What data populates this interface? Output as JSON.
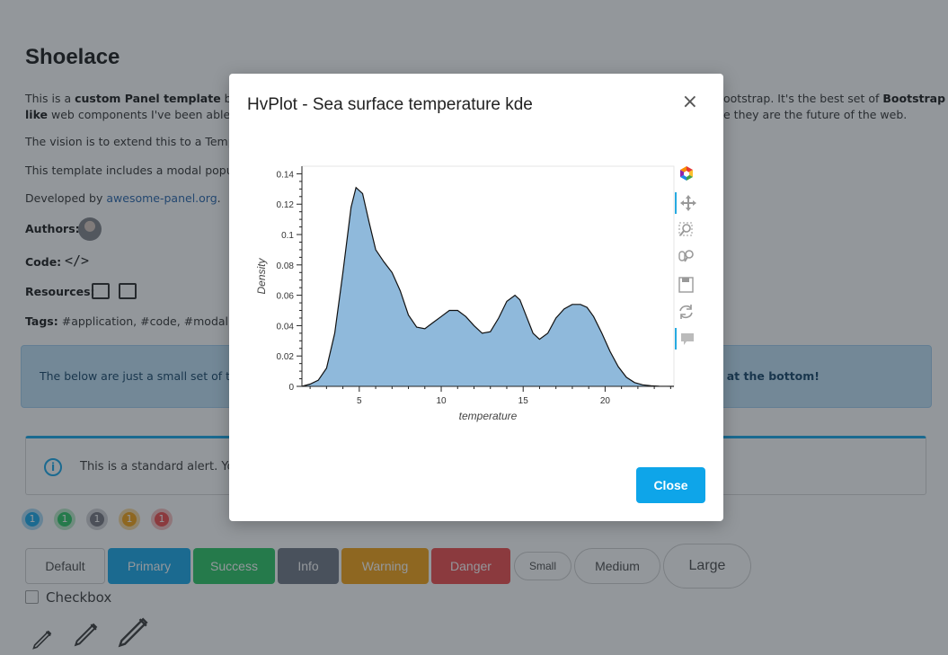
{
  "page": {
    "title": "Shoelace",
    "intro": {
      "text_1": "This is a ",
      "bold_1": "custom Panel template",
      "text_2": " based",
      "text_3": "ootstrap. It's the best set of ",
      "bold_2": "Bootstrap",
      "line2_bold": "like",
      "line2_text": " web components I've been able to",
      "line2_right": "e they are the future of the web."
    },
    "vision": "The vision is to extend this to a Templat",
    "includes": "This template includes a modal popup v",
    "developed_prefix": "Developed by ",
    "developed_link": "awesome-panel.org",
    "developed_suffix": ".",
    "authors_label": "Authors:",
    "code_label": "Code:",
    "code_icon_text": "</>",
    "resources_label": "Resources:",
    "tags_label": "Tags:",
    "tags_text": " #application, #code, #modal, #sh"
  },
  "info_banner": {
    "left_text": "The below are just a small set of the",
    "right_text": "tton at the bottom!"
  },
  "standard_alert": {
    "icon_text": "i",
    "text": "This is a standard alert. You"
  },
  "pills": [
    {
      "label": "1",
      "color": "#0ea5e9",
      "ring": "#a7d8f5"
    },
    {
      "label": "1",
      "color": "#22c55e",
      "ring": "#b6e8c5"
    },
    {
      "label": "1",
      "color": "#71717a",
      "ring": "#d0d0d4"
    },
    {
      "label": "1",
      "color": "#f59e0b",
      "ring": "#f8d99c"
    },
    {
      "label": "1",
      "color": "#ef4444",
      "ring": "#f6bcbc"
    }
  ],
  "buttons": {
    "default": "Default",
    "primary": "Primary",
    "success": "Success",
    "info": "Info",
    "warning": "Warning",
    "danger": "Danger",
    "small": "Small",
    "medium": "Medium",
    "large": "Large"
  },
  "colors": {
    "primary": "#0ea5e9",
    "success": "#22c55e",
    "info": "#6b7280",
    "warning": "#f59e0b",
    "danger": "#ef4444",
    "kde_fill": "#8fb9db"
  },
  "checkbox_label": "Checkbox",
  "modal": {
    "title": "HvPlot - Sea surface temperature kde",
    "close_x": "×",
    "close_button": "Close"
  },
  "toolbar": {
    "icons": [
      "bokeh-logo-icon",
      "pan-icon",
      "box-zoom-icon",
      "wheel-zoom-icon",
      "save-icon",
      "reset-icon",
      "hover-icon"
    ]
  },
  "chart_data": {
    "type": "area",
    "title": "",
    "xlabel": "temperature",
    "ylabel": "Density",
    "xlim": [
      1.5,
      24.2
    ],
    "ylim": [
      0,
      0.145
    ],
    "xticks": [
      5,
      10,
      15,
      20
    ],
    "yticks": [
      0,
      0.02,
      0.04,
      0.06,
      0.08,
      0.1,
      0.12,
      0.14
    ],
    "ytick_labels": [
      "0",
      "0.02",
      "0.04",
      "0.06",
      "0.08",
      "0.1",
      "0.12",
      "0.14"
    ],
    "series": [
      {
        "x": [
          1.5,
          2.0,
          2.5,
          3.0,
          3.5,
          4.0,
          4.5,
          4.8,
          5.2,
          5.6,
          6.0,
          6.5,
          7.0,
          7.5,
          8.0,
          8.5,
          9.0,
          9.5,
          10.0,
          10.5,
          11.0,
          11.5,
          12.0,
          12.5,
          13.0,
          13.5,
          14.0,
          14.5,
          14.8,
          15.2,
          15.6,
          16.0,
          16.5,
          17.0,
          17.5,
          18.0,
          18.5,
          18.9,
          19.3,
          19.8,
          20.3,
          20.8,
          21.3,
          21.8,
          22.3,
          22.8,
          23.3,
          24.2
        ],
        "y": [
          0.0,
          0.0015,
          0.004,
          0.012,
          0.035,
          0.075,
          0.118,
          0.131,
          0.127,
          0.108,
          0.09,
          0.082,
          0.075,
          0.063,
          0.047,
          0.039,
          0.038,
          0.042,
          0.046,
          0.05,
          0.05,
          0.046,
          0.04,
          0.035,
          0.036,
          0.045,
          0.056,
          0.06,
          0.057,
          0.046,
          0.035,
          0.031,
          0.035,
          0.045,
          0.051,
          0.054,
          0.054,
          0.052,
          0.046,
          0.035,
          0.023,
          0.013,
          0.006,
          0.0025,
          0.001,
          0.0004,
          0.0001,
          0.0
        ]
      }
    ],
    "grid": false,
    "legend": "none"
  }
}
